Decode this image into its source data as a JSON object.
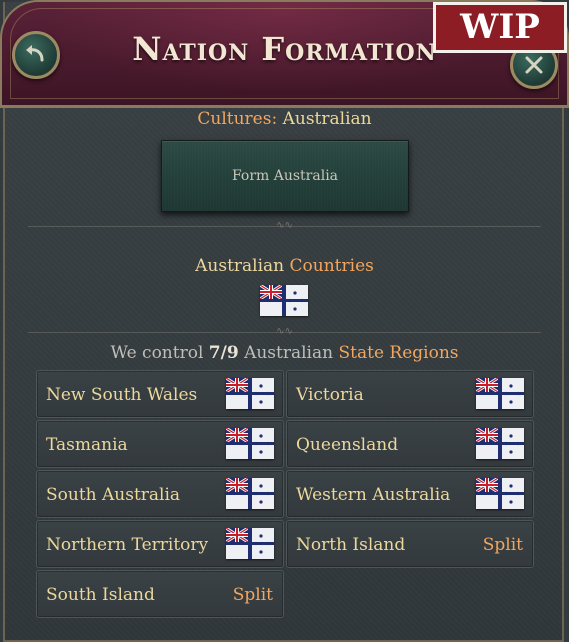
{
  "header": {
    "title": "Nation Formation",
    "wip_label": "WIP"
  },
  "cultures": {
    "label": "Cultures:",
    "value": "Australian"
  },
  "form_button": {
    "label": "Form Australia"
  },
  "countries": {
    "prefix": "Australian",
    "label": "Countries"
  },
  "control": {
    "prefix": "We control",
    "count": "7/9",
    "culture": "Australian",
    "regions_label": "State Regions"
  },
  "states": [
    {
      "name": "New South Wales",
      "status": "flag"
    },
    {
      "name": "Victoria",
      "status": "flag"
    },
    {
      "name": "Tasmania",
      "status": "flag"
    },
    {
      "name": "Queensland",
      "status": "flag"
    },
    {
      "name": "South Australia",
      "status": "flag"
    },
    {
      "name": "Western Australia",
      "status": "flag"
    },
    {
      "name": "Northern Territory",
      "status": "flag"
    },
    {
      "name": "North Island",
      "status": "Split"
    },
    {
      "name": "South Island",
      "status": "Split"
    }
  ],
  "icons": {
    "back": "back-arrow-icon",
    "close": "close-icon",
    "flag": "australian-federation-flag-icon"
  },
  "colors": {
    "gold_text": "#ecd79c",
    "accent_orange": "#f3a65f",
    "header_maroon": "#4a1a2d",
    "wip_red": "#8c1d24"
  }
}
